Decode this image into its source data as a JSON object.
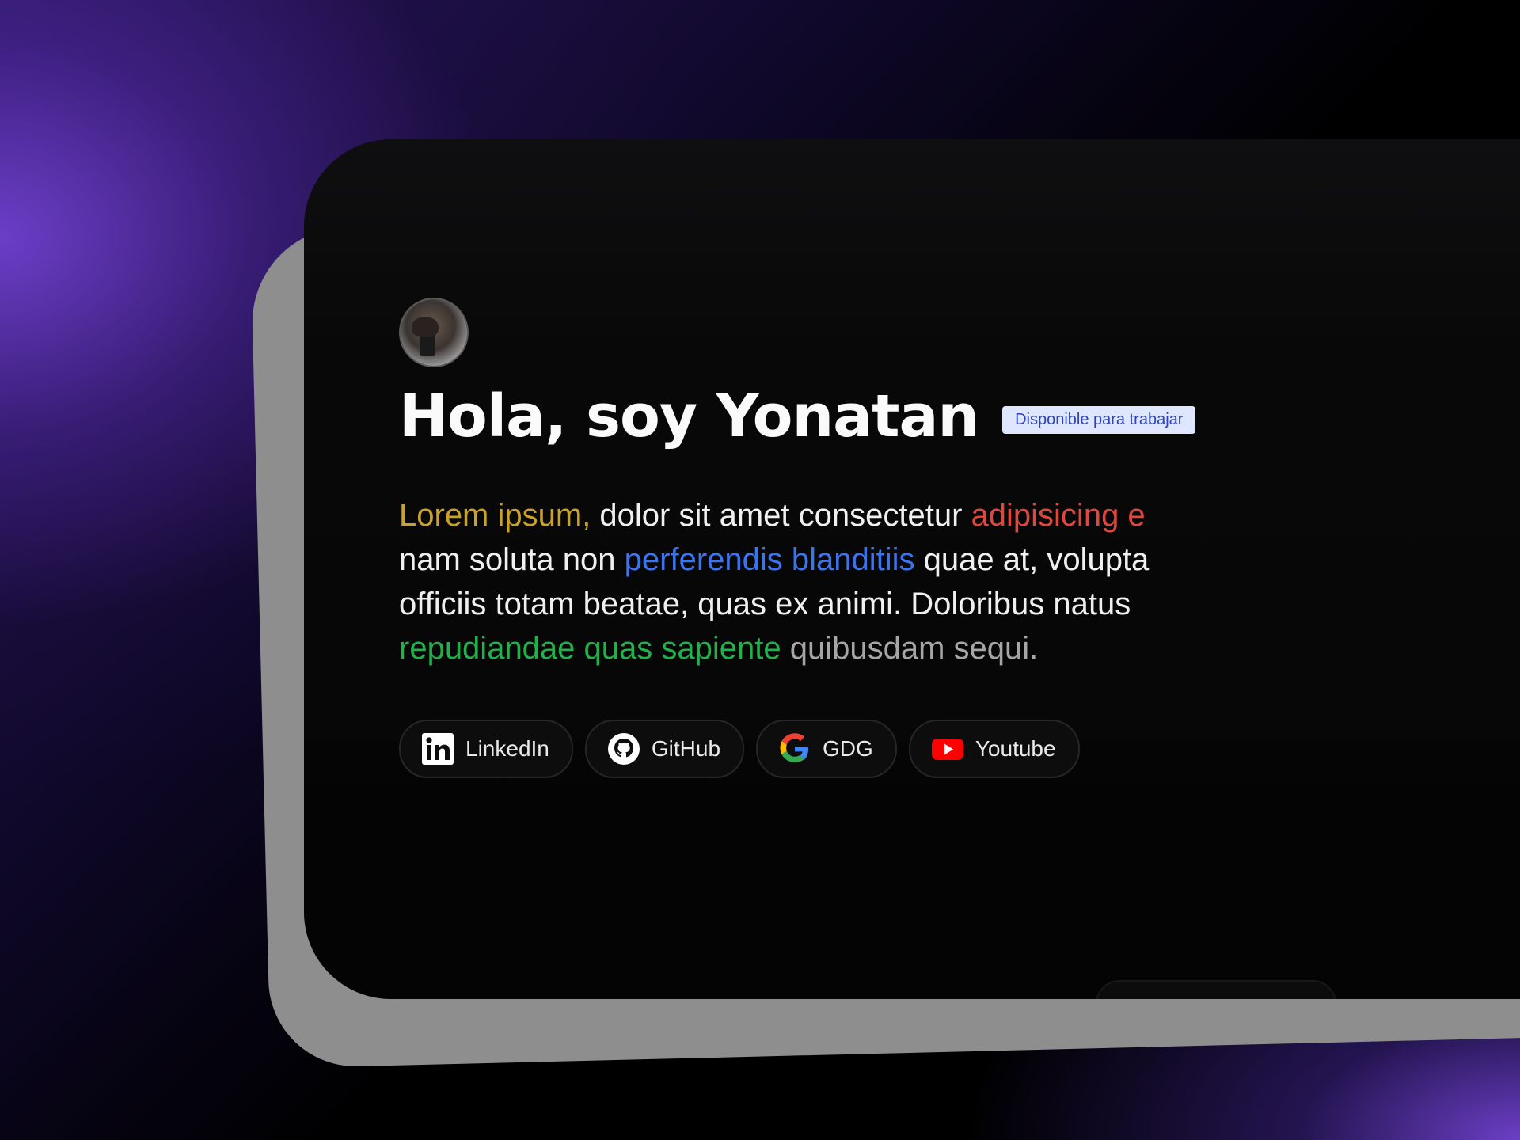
{
  "profile": {
    "name_title": "Hola, soy Yonatan",
    "status_badge": "Disponible para trabajar"
  },
  "bio": {
    "line1": [
      {
        "text": "Lorem ipsum,",
        "color": "yellow"
      },
      {
        "text": " dolor sit amet consectetur ",
        "color": "default"
      },
      {
        "text": "adipisicing e",
        "color": "red"
      }
    ],
    "line2": [
      {
        "text": "nam soluta non ",
        "color": "default"
      },
      {
        "text": "perferendis blanditiis",
        "color": "blue"
      },
      {
        "text": " quae at, volupta",
        "color": "default"
      }
    ],
    "line3": [
      {
        "text": "officiis totam beatae, quas ex animi. Doloribus natus",
        "color": "default"
      }
    ],
    "line4": [
      {
        "text": "repudiandae quas sapiente",
        "color": "green"
      },
      {
        "text": " quibusdam sequi.",
        "color": "gray"
      }
    ]
  },
  "links": [
    {
      "label": "LinkedIn",
      "icon": "linkedin-icon"
    },
    {
      "label": "GitHub",
      "icon": "github-icon"
    },
    {
      "label": "GDG",
      "icon": "google-icon"
    },
    {
      "label": "Youtube",
      "icon": "youtube-icon"
    }
  ],
  "colors": {
    "yellow": "#c9a227",
    "red": "#e0463b",
    "blue": "#3b74f0",
    "green": "#22b04a",
    "gray": "#a6a6a6",
    "badge_bg": "#dfe6ff",
    "badge_text": "#2d43b8"
  }
}
